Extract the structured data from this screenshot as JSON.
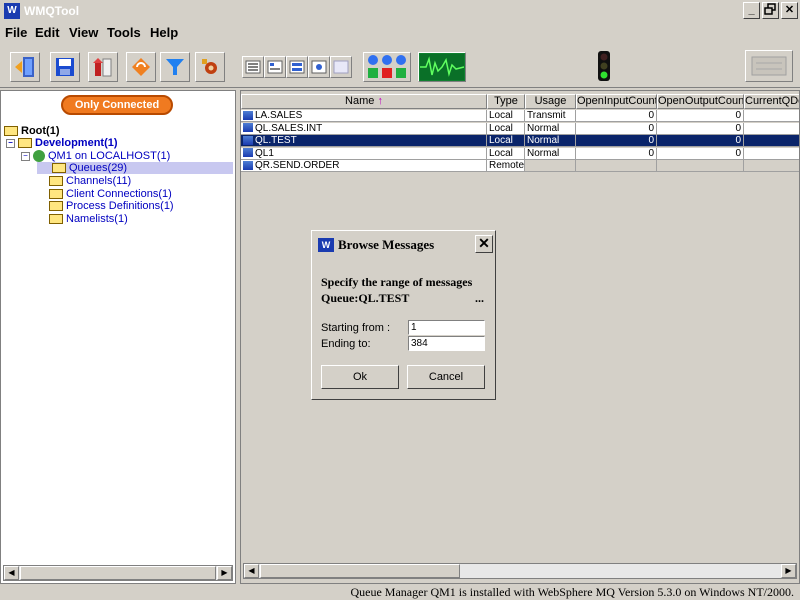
{
  "window": {
    "logo": "W",
    "title": "WMQTool",
    "minimize": "_",
    "restore": "ꟷ",
    "close": "✕"
  },
  "menu": [
    "File",
    "Edit",
    "View",
    "Tools",
    "Help"
  ],
  "toolbar_icons": [
    "exit-door-icon",
    "save-icon",
    "import-icon",
    "refresh-icon",
    "filter-icon",
    "settings-gear-icon",
    "list-view-icon",
    "detail-view-icon",
    "queue-view-icon",
    "channel-view-icon",
    "blank-view-icon",
    "status-lights-icon",
    "monitor-waveform-icon",
    "traffic-light-icon",
    "disabled-panel-icon"
  ],
  "filter_button": "Only Connected",
  "tree": {
    "root": "Root(1)",
    "development": "Development(1)",
    "qmgr": "QM1 on LOCALHOST(1)",
    "queues": "Queues(29)",
    "channels": "Channels(11)",
    "client_connections": "Client Connections(1)",
    "process_definitions": "Process Definitions(1)",
    "namelists": "Namelists(1)"
  },
  "table": {
    "columns": [
      "Name",
      "Type",
      "Usage",
      "OpenInputCount",
      "OpenOutputCount",
      "CurrentQDe"
    ],
    "sort_arrow": "↑",
    "rows": [
      {
        "name": "LA.SALES",
        "type": "Local",
        "usage": "Transmit",
        "open_input": "0",
        "open_output": "0",
        "current": ""
      },
      {
        "name": "QL.SALES.INT",
        "type": "Local",
        "usage": "Normal",
        "open_input": "0",
        "open_output": "0",
        "current": ""
      },
      {
        "name": "QL.TEST",
        "type": "Local",
        "usage": "Normal",
        "open_input": "0",
        "open_output": "0",
        "current": ""
      },
      {
        "name": "QL1",
        "type": "Local",
        "usage": "Normal",
        "open_input": "0",
        "open_output": "0",
        "current": ""
      },
      {
        "name": "QR.SEND.ORDER",
        "type": "Remote",
        "usage": "",
        "open_input": "",
        "open_output": "",
        "current": ""
      }
    ],
    "selected_row": 2
  },
  "dialog": {
    "logo": "W",
    "title": "Browse Messages",
    "close": "✕",
    "instruction": "Specify the range of messages",
    "queue_label": "Queue:QL.TEST",
    "ellipsis": "...",
    "start_label": "Starting from :",
    "start_value": "1",
    "end_label": "Ending to:",
    "end_value": "384",
    "ok": "Ok",
    "cancel": "Cancel"
  },
  "status": "Queue Manager QM1 is installed with WebSphere MQ Version 5.3.0 on Windows NT/2000.",
  "colors": {
    "selection": "#0a246a",
    "filter_button": "#f07a20",
    "link_blue": "#0000c0",
    "tree_selected": "#c8c8f0"
  }
}
